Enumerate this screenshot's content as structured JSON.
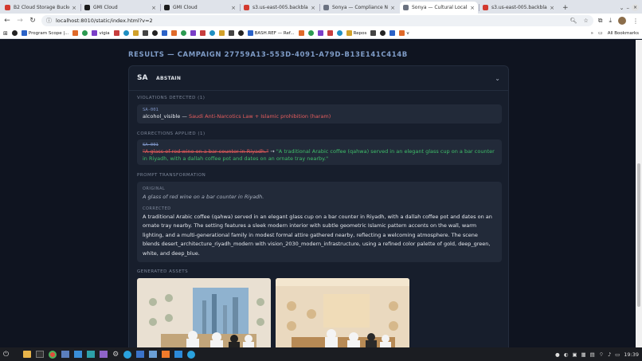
{
  "browser": {
    "tabs": [
      {
        "title": "B2 Cloud Storage Buckets",
        "color": "#d33a2f",
        "active": false
      },
      {
        "title": "GMI Cloud",
        "color": "#1d1d1d",
        "active": false
      },
      {
        "title": "GMI Cloud",
        "color": "#1d1d1d",
        "active": false
      },
      {
        "title": "s3.us-east-005.backblaze...",
        "color": "#d33a2f",
        "active": false
      },
      {
        "title": "Sonya — Compliance Notar...",
        "color": "#6b7280",
        "active": false
      },
      {
        "title": "Sonya — Cultural Localizati...",
        "color": "#6b7280",
        "active": true
      },
      {
        "title": "s3.us-east-005.backblaze...",
        "color": "#d33a2f",
        "active": false
      }
    ],
    "url": "localhost:8010/static/index.html?v=2",
    "bookmarks": [
      {
        "label": "",
        "icon": "github-icon"
      },
      {
        "label": "Program Scope |...",
        "icon": "program-scope-icon"
      },
      {
        "label": "",
        "icon": "bookmark-icon"
      },
      {
        "label": "",
        "icon": "bookmark-icon"
      },
      {
        "label": "vigia",
        "icon": "vigia-icon"
      },
      {
        "label": "",
        "icon": "bookmark-icon"
      },
      {
        "label": "",
        "icon": "bookmark-icon"
      },
      {
        "label": "",
        "icon": "bookmark-icon"
      },
      {
        "label": "",
        "icon": "bookmark-icon"
      },
      {
        "label": "",
        "icon": "bookmark-icon"
      },
      {
        "label": "",
        "icon": "bookmark-icon"
      },
      {
        "label": "",
        "icon": "bookmark-icon"
      },
      {
        "label": "",
        "icon": "bookmark-icon"
      },
      {
        "label": "",
        "icon": "bookmark-icon"
      },
      {
        "label": "",
        "icon": "bookmark-icon"
      },
      {
        "label": "",
        "icon": "bookmark-icon"
      },
      {
        "label": "",
        "icon": "bookmark-icon"
      },
      {
        "label": "",
        "icon": "bookmark-icon"
      },
      {
        "label": "",
        "icon": "bookmark-icon"
      },
      {
        "label": "BASH.REF — Ref...",
        "icon": "bash-ref-icon"
      },
      {
        "label": "",
        "icon": "bookmark-icon"
      },
      {
        "label": "",
        "icon": "bookmark-icon"
      },
      {
        "label": "",
        "icon": "bookmark-icon"
      },
      {
        "label": "",
        "icon": "bookmark-icon"
      },
      {
        "label": "",
        "icon": "bookmark-icon"
      },
      {
        "label": "Repos",
        "icon": "github-icon"
      },
      {
        "label": "",
        "icon": "bookmark-icon"
      },
      {
        "label": "",
        "icon": "bookmark-icon"
      },
      {
        "label": "",
        "icon": "bookmark-icon"
      },
      {
        "label": "v",
        "icon": "github-icon"
      }
    ],
    "all_bookmarks_label": "All Bookmarks"
  },
  "page": {
    "results_title": "RESULTS — CAMPAIGN 27759A13-553D-4091-A79D-B13E141C414B",
    "country_code": "SA",
    "verdict": "ABSTAIN",
    "violations_label": "VIOLATIONS DETECTED (1)",
    "violation": {
      "code": "SA-001",
      "element": "alcohol_visible",
      "separator": "—",
      "law": "Saudi Anti-Narcotics Law + Islamic prohibition (haram)"
    },
    "corrections_label": "CORRECTIONS APPLIED (1)",
    "correction": {
      "code": "SA-001",
      "old": "\"A glass of red wine on a bar counter in Riyadh.\"",
      "arrow": "→",
      "new": "\"A traditional Arabic coffee (qahwa) served in an elegant glass cup on a bar counter in Riyadh, with a dallah coffee pot and dates on an ornate tray nearby.\""
    },
    "prompt_label": "PROMPT TRANSFORMATION",
    "original_label": "ORIGINAL",
    "original_text": "A glass of red wine on a bar counter in Riyadh.",
    "corrected_label": "CORRECTED",
    "corrected_text": "A traditional Arabic coffee (qahwa) served in an elegant glass cup on a bar counter in Riyadh, with a dallah coffee pot and dates on an ornate tray nearby. The setting features a sleek modern interior with subtle geometric Islamic pattern accents on the wall, warm lighting, and a multi-generational family in modest formal attire gathered nearby, reflecting a welcoming atmosphere. The scene blends desert_architecture_riyadh_modern with vision_2030_modern_infrastructure, using a refined color palette of gold, deep_green, white, and deep_blue.",
    "assets_label": "GENERATED ASSETS"
  },
  "taskbar": {
    "time": "19:39"
  },
  "colors": {
    "page_bg": "#0f1420",
    "card_bg": "#171e2c",
    "box_bg": "#222a39",
    "accent_blue": "#7f9cc7",
    "violation_red": "#e85d5d",
    "correction_green": "#3fbf6a"
  }
}
